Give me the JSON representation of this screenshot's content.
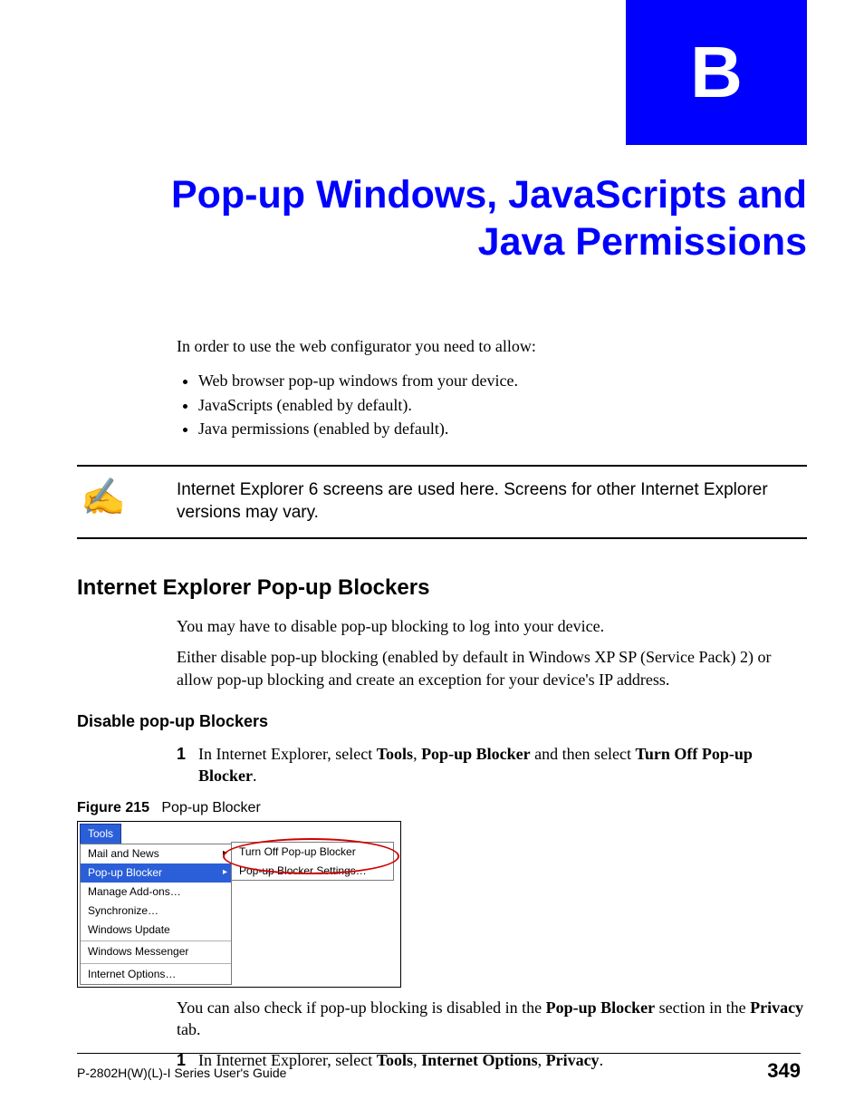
{
  "appendix": {
    "letter": "B"
  },
  "title": "Pop-up Windows, JavaScripts and Java Permissions",
  "intro": "In order to use the web configurator you need to allow:",
  "bullets": [
    "Web browser pop-up windows from your device.",
    "JavaScripts (enabled by default).",
    "Java permissions (enabled by default)."
  ],
  "note": {
    "icon": "✍",
    "text": "Internet Explorer 6 screens are used here. Screens for other Internet Explorer versions may vary."
  },
  "section1": {
    "heading": "Internet Explorer Pop-up Blockers",
    "p1": "You may have to disable pop-up blocking to log into your device.",
    "p2": "Either disable pop-up blocking (enabled by default in Windows XP SP (Service Pack) 2) or allow pop-up blocking and create an exception for your device's IP address."
  },
  "section2": {
    "heading": "Disable pop-up Blockers",
    "step1_num": "1",
    "step1_pre": "In Internet Explorer, select ",
    "step1_b1": "Tools",
    "step1_sep1": ", ",
    "step1_b2": "Pop-up Blocker",
    "step1_sep2": " and then select ",
    "step1_b3": "Turn Off Pop-up Blocker",
    "step1_post": "."
  },
  "figure": {
    "label": "Figure 215",
    "caption": "Pop-up Blocker",
    "tools_label": "Tools",
    "menu": {
      "mail": "Mail and News",
      "popup": "Pop-up Blocker",
      "addons": "Manage Add-ons…",
      "sync": "Synchronize…",
      "update": "Windows Update",
      "messenger": "Windows Messenger",
      "options": "Internet Options…"
    },
    "submenu": {
      "turnoff": "Turn Off Pop-up Blocker",
      "settings": "Pop-up Blocker Settings…"
    }
  },
  "after_fig_pre": "You can also check if pop-up blocking is disabled in the ",
  "after_fig_b1": "Pop-up Blocker",
  "after_fig_mid": " section in the ",
  "after_fig_b2": "Privacy",
  "after_fig_post": " tab.",
  "step2": {
    "num": "1",
    "pre": "In Internet Explorer, select ",
    "b1": "Tools",
    "sep1": ", ",
    "b2": "Internet Options",
    "sep2": ", ",
    "b3": "Privacy",
    "post": "."
  },
  "footer": {
    "guide": "P-2802H(W)(L)-I Series User's Guide",
    "page": "349"
  }
}
